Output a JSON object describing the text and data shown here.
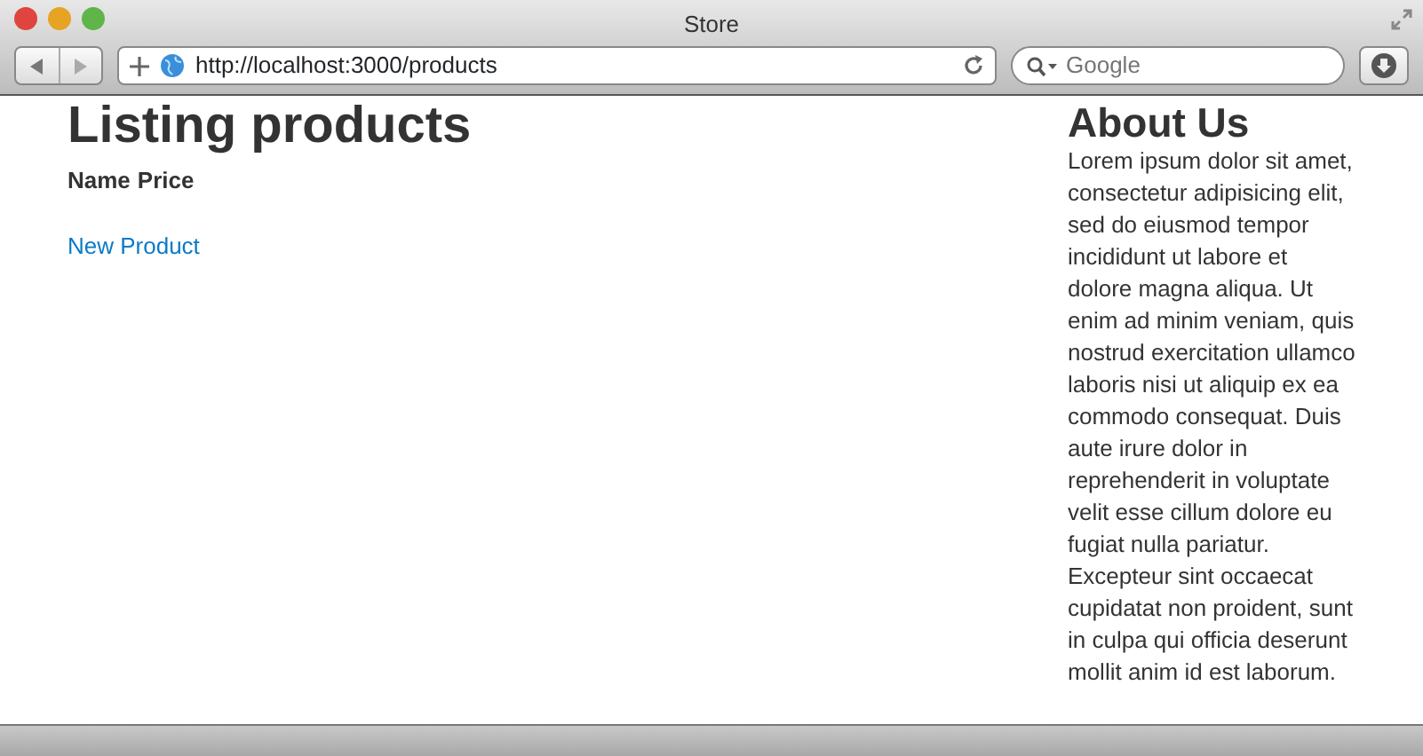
{
  "window": {
    "title": "Store"
  },
  "toolbar": {
    "url": "http://localhost:3000/products",
    "search": {
      "placeholder": "Google"
    }
  },
  "main": {
    "heading": "Listing products",
    "table": {
      "columns": [
        "Name",
        "Price"
      ]
    },
    "link": "New Product"
  },
  "sidebar": {
    "heading": "About Us",
    "text": "Lorem ipsum dolor sit amet, consectetur adipisicing elit, sed do eiusmod tempor incididunt ut labore et dolore magna aliqua. Ut enim ad minim veniam, quis nostrud exercitation ullamco laboris nisi ut aliquip ex ea commodo consequat. Duis aute irure dolor in reprehenderit in voluptate velit esse cillum dolore eu fugiat nulla pariatur. Excepteur sint occaecat cupidatat non proident, sunt in culpa qui officia deserunt mollit anim id est laborum."
  }
}
